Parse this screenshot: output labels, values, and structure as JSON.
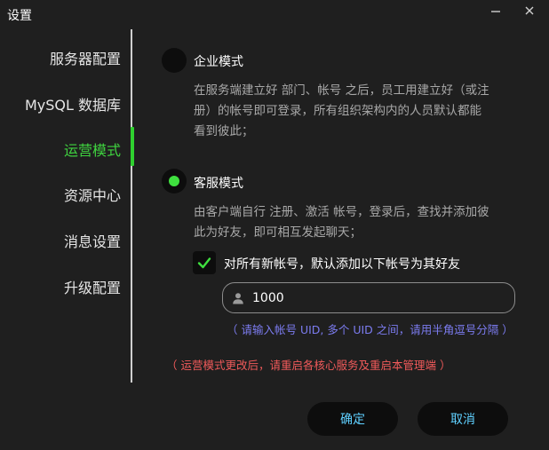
{
  "window": {
    "title": "设置"
  },
  "sidebar": {
    "items": [
      {
        "label": "服务器配置"
      },
      {
        "label": "MySQL 数据库"
      },
      {
        "label": "运营模式",
        "active": true
      },
      {
        "label": "资源中心"
      },
      {
        "label": "消息设置"
      },
      {
        "label": "升级配置"
      }
    ]
  },
  "main": {
    "enterprise": {
      "label": "企业模式",
      "selected": false,
      "desc_line1": "在服务端建立好 部门、帐号 之后，员工用建立好（或注",
      "desc_line2": "册）的帐号即可登录，所有组织架构内的人员默认都能",
      "desc_line3": "看到彼此；"
    },
    "customer": {
      "label": "客服模式",
      "selected": true,
      "desc_line1": "由客户端自行 注册、激活 帐号，登录后，查找并添加彼",
      "desc_line2": "此为好友，即可相互发起聊天；"
    },
    "auto_friend": {
      "label": "对所有新帐号，默认添加以下帐号为其好友",
      "checked": true
    },
    "uid_input": {
      "value": "1000"
    },
    "hint": "（ 请输入帐号 UID, 多个 UID 之间，请用半角逗号分隔 ）",
    "warning": "（ 运营模式更改后，请重启各核心服务及重启本管理端 ）"
  },
  "buttons": {
    "ok": "确定",
    "cancel": "取消"
  },
  "colors": {
    "background": "#1f1f1f",
    "active_green": "#3fd33f",
    "button_text": "#5fd0ff",
    "hint": "#7c7cf0",
    "warning": "#f05a5a"
  },
  "icons": {
    "minimize": "minimize-icon",
    "close": "close-icon",
    "checkmark": "checkmark-icon",
    "user": "user-icon"
  }
}
